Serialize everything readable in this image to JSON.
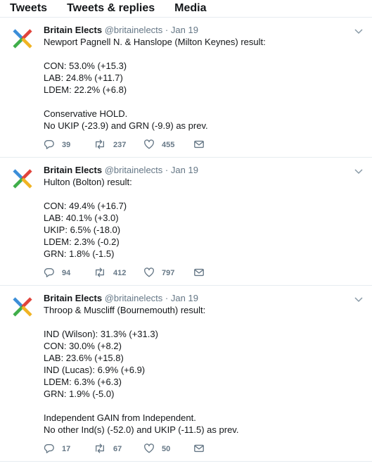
{
  "tabs": [
    "Tweets",
    "Tweets & replies",
    "Media"
  ],
  "tweets": [
    {
      "name": "Britain Elects",
      "handle": "@britainelects",
      "separator": "·",
      "time": "Jan 19",
      "lines": [
        "Newport Pagnell N. & Hanslope (Milton Keynes) result:",
        "",
        "CON: 53.0% (+15.3)",
        "LAB: 24.8% (+11.7)",
        "LDEM: 22.2% (+6.8)",
        "",
        "Conservative HOLD.",
        "No UKIP (-23.9) and GRN (-9.9) as prev."
      ],
      "replies": "39",
      "retweets": "237",
      "likes": "455"
    },
    {
      "name": "Britain Elects",
      "handle": "@britainelects",
      "separator": "·",
      "time": "Jan 19",
      "lines": [
        "Hulton (Bolton) result:",
        "",
        "CON: 49.4% (+16.7)",
        "LAB: 40.1% (+3.0)",
        "UKIP: 6.5% (-18.0)",
        "LDEM: 2.3% (-0.2)",
        "GRN: 1.8% (-1.5)"
      ],
      "replies": "94",
      "retweets": "412",
      "likes": "797"
    },
    {
      "name": "Britain Elects",
      "handle": "@britainelects",
      "separator": "·",
      "time": "Jan 19",
      "lines": [
        "Throop & Muscliff (Bournemouth) result:",
        "",
        "IND (Wilson): 31.3% (+31.3)",
        "CON: 30.0% (+8.2)",
        "LAB: 23.6% (+15.8)",
        "IND (Lucas): 6.9% (+6.9)",
        "LDEM: 6.3% (+6.3)",
        "GRN: 1.9% (-5.0)",
        "",
        "Independent GAIN from Independent.",
        "No other Ind(s) (-52.0) and UKIP (-11.5) as prev."
      ],
      "replies": "17",
      "retweets": "67",
      "likes": "50"
    }
  ],
  "icons": {
    "avatar": "britain-elects-x-logo",
    "reply": "reply-icon",
    "retweet": "retweet-icon",
    "like": "heart-icon",
    "dm": "envelope-icon",
    "menu": "chevron-down-icon"
  },
  "colors": {
    "avatar_blue": "#3b8ed8",
    "avatar_red": "#e0433b",
    "avatar_yellow": "#f0b323",
    "avatar_green": "#3fae49",
    "muted": "#657786",
    "divider": "#e6ecf0"
  }
}
